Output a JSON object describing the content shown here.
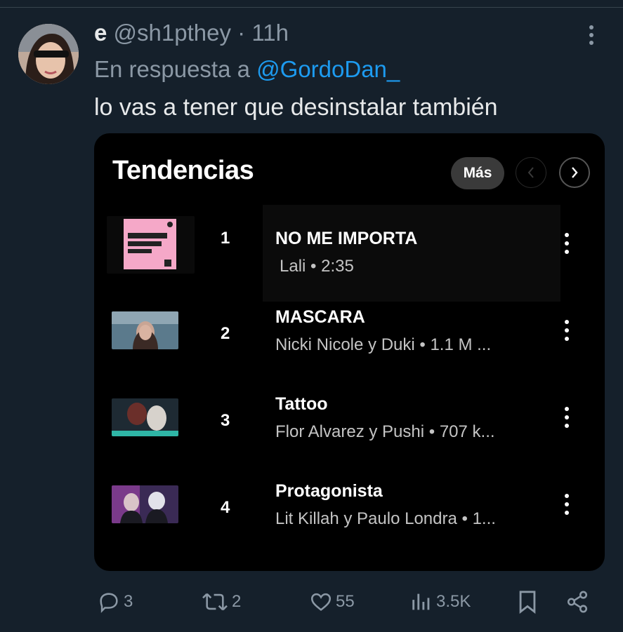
{
  "tweet": {
    "display_name": "e",
    "handle": "@sh1pthey",
    "separator": "·",
    "time": "11h",
    "reply_prefix": "En respuesta a",
    "reply_to": "@GordoDan_",
    "text": "lo vas a tener que desinstalar también"
  },
  "card": {
    "title": "Tendencias",
    "more_label": "Más",
    "tracks": [
      {
        "rank": "1",
        "title": "NO ME IMPORTA",
        "subtitle": "Lali • 2:35"
      },
      {
        "rank": "2",
        "title": "MASCARA",
        "subtitle": "Nicki Nicole y Duki • 1.1 M ..."
      },
      {
        "rank": "3",
        "title": "Tattoo",
        "subtitle": "Flor Alvarez y Pushi • 707 k..."
      },
      {
        "rank": "4",
        "title": "Protagonista",
        "subtitle": "Lit Killah y Paulo Londra • 1..."
      }
    ]
  },
  "actions": {
    "replies": "3",
    "retweets": "2",
    "likes": "55",
    "views": "3.5K"
  },
  "colors": {
    "background": "#15202b",
    "mention": "#1d9bf0",
    "muted": "#8b98a5",
    "card": "#000000"
  },
  "icons": [
    "more-vertical-icon",
    "chevron-left-icon",
    "chevron-right-icon",
    "reply-icon",
    "retweet-icon",
    "heart-icon",
    "views-icon",
    "bookmark-icon",
    "share-icon"
  ]
}
